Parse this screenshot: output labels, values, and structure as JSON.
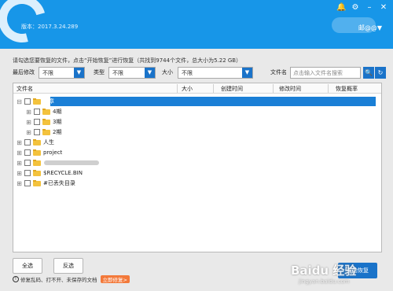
{
  "header": {
    "version": "版本：2017.3.24.289",
    "user": "邮@@▼",
    "icons": [
      "bell-icon",
      "gear-icon",
      "minimize-icon",
      "close-icon"
    ]
  },
  "info_text": "请勾选您要恢复的文件，点击“开始恢复”进行恢复（共找到9744个文件，总大小为5.22 GB）",
  "filters": {
    "modified_label": "最后修改",
    "modified_value": "不限",
    "type_label": "类型",
    "type_value": "不限",
    "size_label": "大小",
    "size_value": "不限",
    "filename_label": "文件名",
    "search_placeholder": "点击输入文件名搜索"
  },
  "table": {
    "columns": [
      "文件名",
      "大小",
      "创建时间",
      "修改时间",
      "恢复概率"
    ],
    "rows": [
      {
        "name": "文章",
        "level": 0,
        "selected": true
      },
      {
        "name": "4期",
        "level": 1,
        "selected": false
      },
      {
        "name": "3期",
        "level": 1,
        "selected": false
      },
      {
        "name": "2期",
        "level": 1,
        "selected": false
      },
      {
        "name": "人生",
        "level": 0,
        "selected": false
      },
      {
        "name": "project",
        "level": 0,
        "selected": false
      },
      {
        "name": "",
        "level": 0,
        "selected": false,
        "blurred": true
      },
      {
        "name": "$RECYCLE.BIN",
        "level": 0,
        "selected": false
      },
      {
        "name": "#已丢失目录",
        "level": 0,
        "selected": false
      }
    ]
  },
  "buttons": {
    "select_all": "全选",
    "invert": "反选",
    "start": "开始恢复"
  },
  "warning": {
    "text": "修复乱码、打不开、未保存的文档",
    "tag": "立即修复>"
  },
  "watermark": {
    "line1": "Baidu 经验",
    "line2": "jingyan.baidu.com"
  },
  "colors": {
    "header": "#1796e8",
    "accent": "#1a73c9",
    "selection": "#1a7fd6",
    "warn_tag": "#f3793a"
  }
}
